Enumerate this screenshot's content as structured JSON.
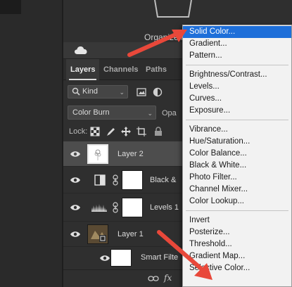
{
  "libraries": {
    "organize_text": "Organize li"
  },
  "tabs": [
    {
      "label": "Layers",
      "active": true
    },
    {
      "label": "Channels",
      "active": false
    },
    {
      "label": "Paths",
      "active": false
    }
  ],
  "filter": {
    "kind_label": "Kind"
  },
  "blend": {
    "mode": "Color Burn",
    "opacity_label": "Opa"
  },
  "lock": {
    "label": "Lock:"
  },
  "layers": [
    {
      "name": "Layer 2",
      "selected": true
    },
    {
      "name": "Black &",
      "adjustment": "black-white"
    },
    {
      "name": "Levels 1",
      "adjustment": "levels"
    },
    {
      "name": "Layer 1"
    },
    {
      "name": "Smart Filte"
    }
  ],
  "bottom_bar": {
    "fx_label": "fx"
  },
  "menu": {
    "groups": [
      [
        "Solid Color...",
        "Gradient...",
        "Pattern..."
      ],
      [
        "Brightness/Contrast...",
        "Levels...",
        "Curves...",
        "Exposure..."
      ],
      [
        "Vibrance...",
        "Hue/Saturation...",
        "Color Balance...",
        "Black & White...",
        "Photo Filter...",
        "Channel Mixer...",
        "Color Lookup..."
      ],
      [
        "Invert",
        "Posterize...",
        "Threshold...",
        "Gradient Map...",
        "Selective Color..."
      ]
    ],
    "highlighted": "Solid Color..."
  },
  "colors": {
    "menu_highlight": "#1e6fd9",
    "arrow": "#e8483a",
    "panel_bg": "#2f2f2f",
    "selected_row": "#4d4d4d"
  }
}
